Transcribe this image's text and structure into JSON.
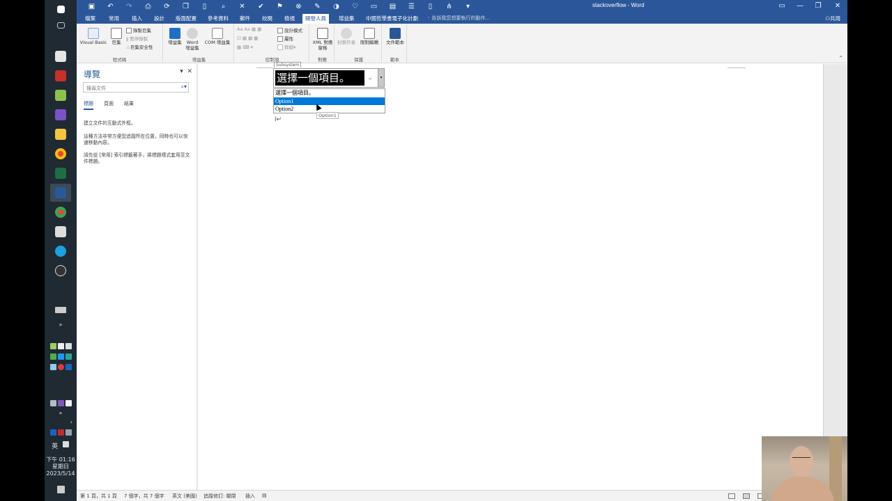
{
  "taskbar": {
    "tray": {
      "ime": "英",
      "time": "下午 01:16",
      "weekday": "星期日",
      "date": "2023/5/14"
    }
  },
  "window": {
    "title": "stackoverflow - Word",
    "tell_me": "告訴我您想要執行的動作...",
    "share": "共用",
    "tabs": [
      {
        "label": "檔案",
        "active": false
      },
      {
        "label": "常用",
        "active": false
      },
      {
        "label": "插入",
        "active": false
      },
      {
        "label": "設計",
        "active": false
      },
      {
        "label": "版面配置",
        "active": false
      },
      {
        "label": "參考資料",
        "active": false
      },
      {
        "label": "郵件",
        "active": false
      },
      {
        "label": "校閱",
        "active": false
      },
      {
        "label": "檢視",
        "active": false
      },
      {
        "label": "開發人員",
        "active": true
      },
      {
        "label": "增益集",
        "active": false
      },
      {
        "label": "中國哲學書電子化計劃",
        "active": false
      }
    ]
  },
  "ribbon": {
    "code": {
      "label": "程式碼",
      "visual_basic": "Visual Basic",
      "macros": "巨集",
      "record_macro": "錄製巨集",
      "pause_recording": "暫停錄製",
      "macro_security": "巨集安全性"
    },
    "addins": {
      "label": "增益集",
      "addins": "增益集",
      "word_addins": "Word 增益集",
      "com_addins": "COM 增益集"
    },
    "controls": {
      "label": "控制項",
      "design_mode": "設計模式",
      "properties": "屬性",
      "group": "群組"
    },
    "mapping": {
      "label": "對應",
      "xml_mapping": "XML 對應窗格"
    },
    "protect": {
      "label": "保護",
      "block_authors": "封鎖作者",
      "restrict_editing": "限制編輯"
    },
    "templates": {
      "label": "範本",
      "document_template": "文件範本"
    }
  },
  "nav_pane": {
    "title": "導覽",
    "search_placeholder": "搜尋文件",
    "tabs": [
      {
        "label": "標題",
        "active": true
      },
      {
        "label": "頁面",
        "active": false
      },
      {
        "label": "結果",
        "active": false
      }
    ],
    "text1": "建立文件的互動式外框。",
    "text2": "這種方法非常方便您追蹤所在位置，同時也可以快速移動內容。",
    "text3": "請先從 [常用] 索引標籤著手，將標題樣式套用至文件標題。"
  },
  "document": {
    "content_control": {
      "tag": "Subsystem",
      "placeholder": "選擇一個項目。",
      "options": [
        {
          "label": "選擇一個項目。",
          "selected": false
        },
        {
          "label": "Option1",
          "selected": true
        },
        {
          "label": "Option2",
          "selected": false
        }
      ]
    },
    "tooltip": "Option1"
  },
  "status_bar": {
    "page": "第 1 頁，共 1 頁",
    "words": "7 個字，共 7 個字",
    "language": "英文 (美國)",
    "track_changes": "追蹤修訂: 關閉",
    "mode": "插入"
  },
  "colors": {
    "word_blue": "#2b579a",
    "selection_blue": "#0078d7",
    "taskbar": "#1f2a33"
  }
}
